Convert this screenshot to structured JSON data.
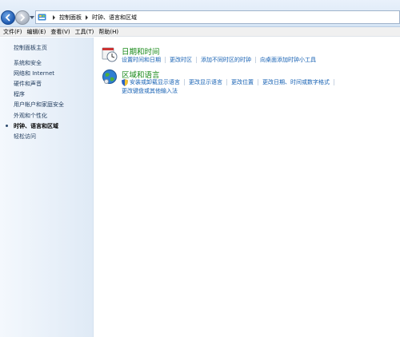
{
  "address_bar": {
    "breadcrumbs": [
      "控制面板",
      "时钟、语言和区域"
    ]
  },
  "menu": {
    "items": [
      "文件(F)",
      "编辑(E)",
      "查看(V)",
      "工具(T)",
      "帮助(H)"
    ]
  },
  "sidebar": {
    "items": [
      {
        "label": "控制面板主页"
      },
      {
        "label": "系统和安全"
      },
      {
        "label": "网络和 Internet"
      },
      {
        "label": "硬件和声音"
      },
      {
        "label": "程序"
      },
      {
        "label": "用户帐户和家庭安全"
      },
      {
        "label": "外观和个性化"
      },
      {
        "label": "时钟、语言和区域",
        "active": true
      },
      {
        "label": "轻松访问"
      }
    ]
  },
  "categories": [
    {
      "title": "日期和时间",
      "icon": "clock-icon",
      "tasks": [
        "设置时间和日期",
        "更改时区",
        "添加不同时区的时钟",
        "向桌面添加时钟小工具"
      ]
    },
    {
      "title": "区域和语言",
      "icon": "globe-icon",
      "tasks": [
        "安装或卸载显示语言",
        "更改显示语言",
        "更改位置",
        "更改日期、时间或数字格式"
      ],
      "tasks_line2": [
        "更改键盘或其他输入法"
      ]
    }
  ],
  "colors": {
    "link": "#1560b3",
    "category_title": "#1a8a1a",
    "sidebar_text": "#1e395b"
  }
}
